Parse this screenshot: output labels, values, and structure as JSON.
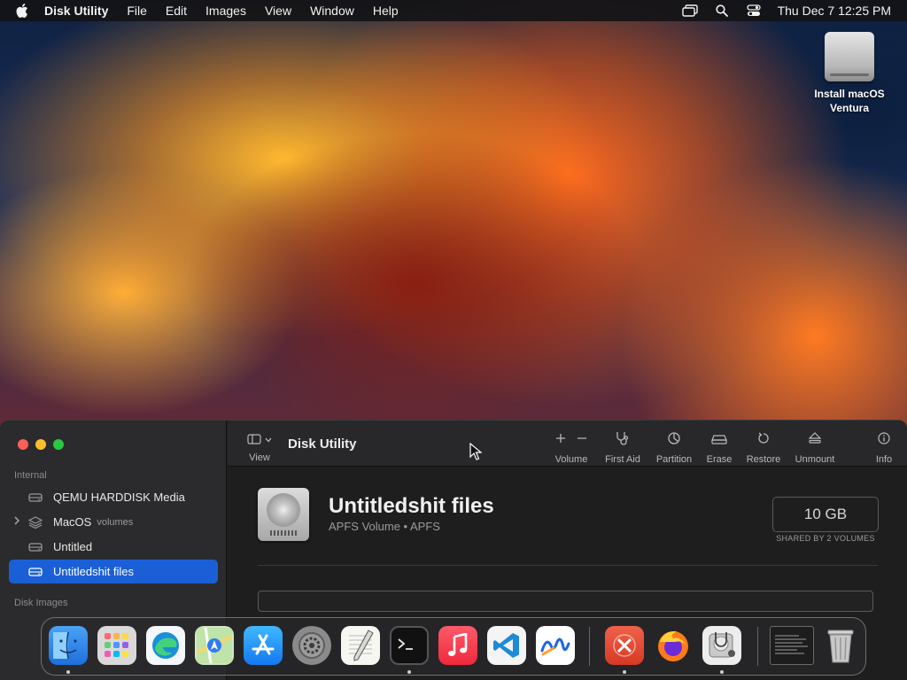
{
  "menubar": {
    "app_name": "Disk Utility",
    "menus": [
      "File",
      "Edit",
      "Images",
      "View",
      "Window",
      "Help"
    ],
    "clock": "Thu Dec 7  12:25 PM"
  },
  "desktop": {
    "icon_label_line1": "Install macOS",
    "icon_label_line2": "Ventura"
  },
  "window": {
    "title": "Disk Utility",
    "toolbar": {
      "view": "View",
      "volume": "Volume",
      "first_aid": "First Aid",
      "partition": "Partition",
      "erase": "Erase",
      "restore": "Restore",
      "unmount": "Unmount",
      "info": "Info"
    },
    "sidebar": {
      "internal_label": "Internal",
      "items": [
        {
          "label": "QEMU HARDDISK Media",
          "sub": ""
        },
        {
          "label": "MacOS",
          "sub": "volumes"
        },
        {
          "label": "Untitled",
          "sub": ""
        },
        {
          "label": "Untitledshit files",
          "sub": ""
        }
      ],
      "disk_images_label": "Disk Images"
    },
    "volume": {
      "name": "Untitledshit files",
      "subtitle": "APFS Volume • APFS",
      "size": "10 GB",
      "shared": "SHARED BY 2 VOLUMES",
      "usage_fraction": 0
    }
  },
  "dock": {
    "apps": [
      "Finder",
      "Launchpad",
      "Microsoft Edge",
      "Maps",
      "App Store",
      "System Settings",
      "TextEdit",
      "Terminal",
      "Music",
      "Visual Studio Code",
      "Freeform",
      "Microsoft Remote Desktop",
      "Firefox",
      "Disk Utility",
      "Screenshot",
      "Trash"
    ]
  },
  "colors": {
    "accent": "#1a5fd6",
    "close": "#ff5f57",
    "minimize": "#febc2e",
    "maximize": "#28c840"
  }
}
